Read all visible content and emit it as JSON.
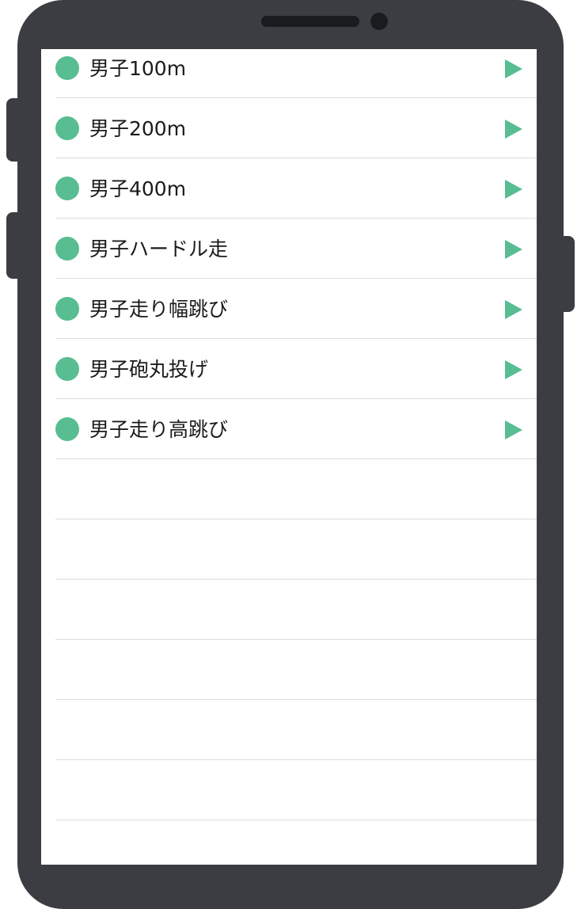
{
  "colors": {
    "accent": "#58bd91",
    "phone_body": "#3c3d42",
    "separator": "#dcdcdc"
  },
  "event_list": {
    "items": [
      {
        "label": "男子100m",
        "icon": "circle-bullet-icon",
        "chevron": "play-arrow-icon"
      },
      {
        "label": "男子200m",
        "icon": "circle-bullet-icon",
        "chevron": "play-arrow-icon"
      },
      {
        "label": "男子400m",
        "icon": "circle-bullet-icon",
        "chevron": "play-arrow-icon"
      },
      {
        "label": "男子ハードル走",
        "icon": "circle-bullet-icon",
        "chevron": "play-arrow-icon"
      },
      {
        "label": "男子走り幅跳び",
        "icon": "circle-bullet-icon",
        "chevron": "play-arrow-icon"
      },
      {
        "label": "男子砲丸投げ",
        "icon": "circle-bullet-icon",
        "chevron": "play-arrow-icon"
      },
      {
        "label": "男子走り高跳び",
        "icon": "circle-bullet-icon",
        "chevron": "play-arrow-icon"
      }
    ],
    "empty_rows": 7
  }
}
